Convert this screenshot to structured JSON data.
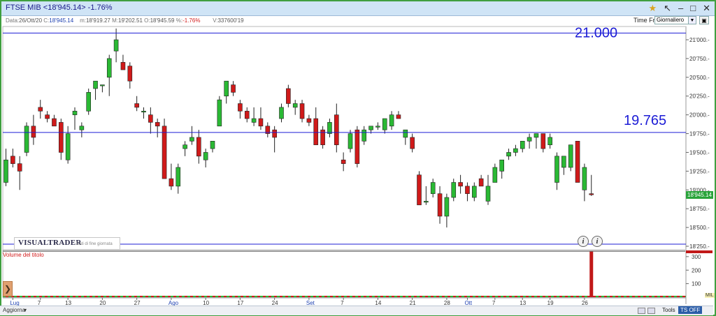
{
  "window": {
    "title": "FTSE MIB  <18'945.14>  -1.76%",
    "icons": [
      "star-icon",
      "arrow-diagonal-icon",
      "minimize-icon",
      "maximize-icon",
      "close-icon"
    ]
  },
  "timeframe": {
    "label": "Time Frame",
    "selected": "Giornaliero"
  },
  "quote": {
    "date_label": "Data:",
    "date": "26/Ott/20",
    "close_label": "C:",
    "close": "18'945.14",
    "min_label": "m:",
    "min": "18'919.27",
    "max_label": "M:",
    "max": "19'202.51",
    "open_label": "O:",
    "open": "18'945.59",
    "pct_label": "%:",
    "pct": "-1.76%",
    "vol_label": "V:",
    "vol": "337600'19"
  },
  "levels": {
    "upper": "21.000",
    "lower": "19.765",
    "upper_value": 21090,
    "lower_value": 19765
  },
  "current_price": {
    "label": "18'945.14",
    "value": 18945.14
  },
  "price_axis": {
    "min": 18250,
    "max": 21250,
    "ticks": [
      {
        "value": 21000,
        "label": "21'000.-"
      },
      {
        "value": 20750,
        "label": "20'750.-"
      },
      {
        "value": 20500,
        "label": "20'500.-"
      },
      {
        "value": 20250,
        "label": "20'250.-"
      },
      {
        "value": 20000,
        "label": "20'000.-"
      },
      {
        "value": 19750,
        "label": "19'750.-"
      },
      {
        "value": 19500,
        "label": "19'500.-"
      },
      {
        "value": 19250,
        "label": "19'250.-"
      },
      {
        "value": 19000,
        "label": "19'000.-"
      },
      {
        "value": 18750,
        "label": "18'750.-"
      },
      {
        "value": 18500,
        "label": "18'500.-"
      },
      {
        "value": 18250,
        "label": "18'250.-"
      }
    ]
  },
  "logo": {
    "name": "VISUALTRADER",
    "subtitle": "Dati di fine giornata"
  },
  "volume": {
    "title": "Volume del titolo",
    "unit": "MIL",
    "ticks": [
      {
        "value": 300,
        "label": "300"
      },
      {
        "value": 200,
        "label": "200"
      },
      {
        "value": 100,
        "label": "100"
      }
    ],
    "max": 320,
    "last_volume": 337
  },
  "date_axis": {
    "labels": [
      {
        "i": 1,
        "text": "Lug",
        "month": true
      },
      {
        "i": 5,
        "text": "7"
      },
      {
        "i": 9,
        "text": "13"
      },
      {
        "i": 14,
        "text": "20"
      },
      {
        "i": 19,
        "text": "27"
      },
      {
        "i": 24,
        "text": "Ago",
        "month": true
      },
      {
        "i": 29,
        "text": "10"
      },
      {
        "i": 34,
        "text": "17"
      },
      {
        "i": 39,
        "text": "24"
      },
      {
        "i": 44,
        "text": "Set",
        "month": true
      },
      {
        "i": 49,
        "text": "7"
      },
      {
        "i": 54,
        "text": "14"
      },
      {
        "i": 59,
        "text": "21"
      },
      {
        "i": 64,
        "text": "28"
      },
      {
        "i": 67,
        "text": "Ott",
        "month": true
      },
      {
        "i": 71,
        "text": "7"
      },
      {
        "i": 75,
        "text": "13"
      },
      {
        "i": 79,
        "text": "19"
      },
      {
        "i": 84,
        "text": "26"
      }
    ]
  },
  "status": {
    "refresh": "Aggiorna",
    "tools": "Tools",
    "tsoff": "TS OFF"
  },
  "chart_data": {
    "type": "candlestick",
    "candles": [
      {
        "o": 19100,
        "h": 19550,
        "l": 19050,
        "c": 19400
      },
      {
        "o": 19450,
        "h": 19550,
        "l": 19300,
        "c": 19350
      },
      {
        "o": 19350,
        "h": 19450,
        "l": 19000,
        "c": 19250
      },
      {
        "o": 19500,
        "h": 19900,
        "l": 19450,
        "c": 19850
      },
      {
        "o": 19850,
        "h": 20000,
        "l": 19600,
        "c": 19700
      },
      {
        "o": 20100,
        "h": 20200,
        "l": 19950,
        "c": 20050
      },
      {
        "o": 20000,
        "h": 20050,
        "l": 19900,
        "c": 19950
      },
      {
        "o": 19950,
        "h": 20000,
        "l": 19850,
        "c": 19850
      },
      {
        "o": 19900,
        "h": 19950,
        "l": 19400,
        "c": 19500
      },
      {
        "o": 19400,
        "h": 19850,
        "l": 19350,
        "c": 19750
      },
      {
        "o": 20000,
        "h": 20100,
        "l": 19800,
        "c": 20050
      },
      {
        "o": 19800,
        "h": 19900,
        "l": 19700,
        "c": 19850
      },
      {
        "o": 20050,
        "h": 20350,
        "l": 20000,
        "c": 20300
      },
      {
        "o": 20350,
        "h": 20450,
        "l": 20200,
        "c": 20450
      },
      {
        "o": 20400,
        "h": 20400,
        "l": 20300,
        "c": 20400
      },
      {
        "o": 20500,
        "h": 20800,
        "l": 20250,
        "c": 20750
      },
      {
        "o": 20850,
        "h": 21150,
        "l": 20700,
        "c": 21000
      },
      {
        "o": 20700,
        "h": 20800,
        "l": 20600,
        "c": 20600
      },
      {
        "o": 20650,
        "h": 20700,
        "l": 20350,
        "c": 20450
      },
      {
        "o": 20150,
        "h": 20250,
        "l": 20050,
        "c": 20100
      },
      {
        "o": 20050,
        "h": 20100,
        "l": 19950,
        "c": 20050
      },
      {
        "o": 20000,
        "h": 20100,
        "l": 19750,
        "c": 19900
      },
      {
        "o": 19900,
        "h": 19950,
        "l": 19700,
        "c": 19850
      },
      {
        "o": 19850,
        "h": 19950,
        "l": 19650,
        "c": 19150
      },
      {
        "o": 19150,
        "h": 19350,
        "l": 19000,
        "c": 19050
      },
      {
        "o": 19050,
        "h": 19350,
        "l": 18950,
        "c": 19300
      },
      {
        "o": 19550,
        "h": 19650,
        "l": 19450,
        "c": 19600
      },
      {
        "o": 19650,
        "h": 19850,
        "l": 19600,
        "c": 19700
      },
      {
        "o": 19700,
        "h": 19800,
        "l": 19350,
        "c": 19450
      },
      {
        "o": 19400,
        "h": 19550,
        "l": 19300,
        "c": 19500
      },
      {
        "o": 19550,
        "h": 19650,
        "l": 19500,
        "c": 19650
      },
      {
        "o": 19850,
        "h": 20250,
        "l": 19850,
        "c": 20200
      },
      {
        "o": 20250,
        "h": 20450,
        "l": 20150,
        "c": 20450
      },
      {
        "o": 20400,
        "h": 20450,
        "l": 20250,
        "c": 20300
      },
      {
        "o": 20150,
        "h": 20200,
        "l": 19950,
        "c": 20050
      },
      {
        "o": 20050,
        "h": 20100,
        "l": 19900,
        "c": 19950
      },
      {
        "o": 19900,
        "h": 20100,
        "l": 19850,
        "c": 19950
      },
      {
        "o": 19950,
        "h": 20100,
        "l": 19800,
        "c": 19850
      },
      {
        "o": 19850,
        "h": 19900,
        "l": 19700,
        "c": 19750
      },
      {
        "o": 19800,
        "h": 19850,
        "l": 19500,
        "c": 19700
      },
      {
        "o": 19950,
        "h": 20150,
        "l": 19900,
        "c": 20100
      },
      {
        "o": 20350,
        "h": 20400,
        "l": 20100,
        "c": 20150
      },
      {
        "o": 20100,
        "h": 20200,
        "l": 20000,
        "c": 20150
      },
      {
        "o": 20150,
        "h": 20200,
        "l": 19900,
        "c": 19950
      },
      {
        "o": 19950,
        "h": 20000,
        "l": 19850,
        "c": 19900
      },
      {
        "o": 19950,
        "h": 20100,
        "l": 19650,
        "c": 19600
      },
      {
        "o": 19800,
        "h": 19850,
        "l": 19550,
        "c": 19600
      },
      {
        "o": 19750,
        "h": 19950,
        "l": 19700,
        "c": 19900
      },
      {
        "o": 20000,
        "h": 20150,
        "l": 19500,
        "c": 19600
      },
      {
        "o": 19400,
        "h": 19500,
        "l": 19250,
        "c": 19350
      },
      {
        "o": 19550,
        "h": 19800,
        "l": 19500,
        "c": 19750
      },
      {
        "o": 19800,
        "h": 19850,
        "l": 19300,
        "c": 19350
      },
      {
        "o": 19650,
        "h": 19850,
        "l": 19600,
        "c": 19800
      },
      {
        "o": 19800,
        "h": 19850,
        "l": 19750,
        "c": 19850
      },
      {
        "o": 19850,
        "h": 19900,
        "l": 19800,
        "c": 19850
      },
      {
        "o": 19800,
        "h": 19950,
        "l": 19750,
        "c": 19950
      },
      {
        "o": 19850,
        "h": 20050,
        "l": 19800,
        "c": 20000
      },
      {
        "o": 20000,
        "h": 20050,
        "l": 19950,
        "c": 19950
      },
      {
        "o": 19700,
        "h": 19800,
        "l": 19600,
        "c": 19800
      },
      {
        "o": 19700,
        "h": 19750,
        "l": 19500,
        "c": 19550
      },
      {
        "o": 19200,
        "h": 19250,
        "l": 18800,
        "c": 18800
      },
      {
        "o": 18850,
        "h": 19050,
        "l": 18800,
        "c": 18850
      },
      {
        "o": 18950,
        "h": 19150,
        "l": 18900,
        "c": 19100
      },
      {
        "o": 18950,
        "h": 19050,
        "l": 18550,
        "c": 18650
      },
      {
        "o": 18650,
        "h": 18950,
        "l": 18500,
        "c": 18900
      },
      {
        "o": 18900,
        "h": 19150,
        "l": 18850,
        "c": 19100
      },
      {
        "o": 19100,
        "h": 19200,
        "l": 18950,
        "c": 19050
      },
      {
        "o": 19050,
        "h": 19100,
        "l": 18850,
        "c": 18950
      },
      {
        "o": 18900,
        "h": 19100,
        "l": 18850,
        "c": 19050
      },
      {
        "o": 19150,
        "h": 19200,
        "l": 19050,
        "c": 19050
      },
      {
        "o": 18850,
        "h": 19200,
        "l": 18800,
        "c": 19050
      },
      {
        "o": 19100,
        "h": 19350,
        "l": 19100,
        "c": 19300
      },
      {
        "o": 19250,
        "h": 19400,
        "l": 19150,
        "c": 19400
      },
      {
        "o": 19450,
        "h": 19550,
        "l": 19400,
        "c": 19500
      },
      {
        "o": 19500,
        "h": 19600,
        "l": 19450,
        "c": 19550
      },
      {
        "o": 19550,
        "h": 19650,
        "l": 19500,
        "c": 19650
      },
      {
        "o": 19650,
        "h": 19750,
        "l": 19550,
        "c": 19700
      },
      {
        "o": 19700,
        "h": 19750,
        "l": 19550,
        "c": 19750
      },
      {
        "o": 19750,
        "h": 19750,
        "l": 19500,
        "c": 19550
      },
      {
        "o": 19600,
        "h": 19750,
        "l": 19550,
        "c": 19700
      },
      {
        "o": 19100,
        "h": 19500,
        "l": 19000,
        "c": 19450
      },
      {
        "o": 19300,
        "h": 19450,
        "l": 19200,
        "c": 19450
      },
      {
        "o": 19300,
        "h": 19600,
        "l": 19250,
        "c": 19600
      },
      {
        "o": 19650,
        "h": 19650,
        "l": 19100,
        "c": 19100
      },
      {
        "o": 19000,
        "h": 19350,
        "l": 18850,
        "c": 19300
      },
      {
        "o": 18950,
        "h": 19200,
        "l": 18920,
        "c": 18945
      }
    ]
  }
}
